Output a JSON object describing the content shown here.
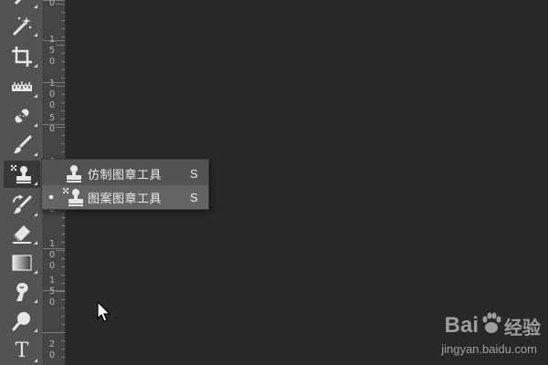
{
  "toolbar": {
    "tools": [
      {
        "name": "quick-selection-tool",
        "icon": "quick-selection-icon",
        "active": false
      },
      {
        "name": "magic-wand-tool",
        "icon": "magic-wand-icon",
        "active": false
      },
      {
        "name": "crop-tool",
        "icon": "crop-icon",
        "active": false
      },
      {
        "name": "ruler-tool",
        "icon": "ruler-icon",
        "active": false
      },
      {
        "name": "healing-brush-tool",
        "icon": "healing-bandage-icon",
        "active": false
      },
      {
        "name": "brush-tool",
        "icon": "brush-icon",
        "active": false
      },
      {
        "name": "pattern-stamp-tool",
        "icon": "pattern-stamp-icon",
        "active": true
      },
      {
        "name": "history-brush-tool",
        "icon": "history-brush-icon",
        "active": false
      },
      {
        "name": "eraser-tool",
        "icon": "eraser-icon",
        "active": false
      },
      {
        "name": "gradient-tool",
        "icon": "gradient-icon",
        "active": false
      },
      {
        "name": "smudge-tool",
        "icon": "smudge-finger-icon",
        "active": false
      },
      {
        "name": "dodge-tool",
        "icon": "dodge-icon",
        "active": false
      },
      {
        "name": "type-tool",
        "icon": "type-icon",
        "active": false
      }
    ],
    "type_tool_glyph": "T"
  },
  "ruler": {
    "labels": [
      {
        "digits": [
          "0"
        ]
      },
      {
        "digits": [
          "1",
          "5",
          "0"
        ]
      },
      {
        "digits": [
          "1",
          "0",
          "0"
        ]
      },
      {
        "digits": [
          "5",
          "0"
        ]
      },
      {
        "digits": [
          "0"
        ]
      },
      {
        "digits": [
          "5",
          "0"
        ]
      },
      {
        "digits": [
          "1",
          "0",
          "0"
        ]
      },
      {
        "digits": [
          "1",
          "5",
          "0"
        ]
      },
      {
        "digits": [
          "2",
          "0"
        ]
      }
    ]
  },
  "flyout": {
    "items": [
      {
        "label": "仿制图章工具",
        "shortcut": "S",
        "icon": "clone-stamp-icon",
        "selected": false
      },
      {
        "label": "图案图章工具",
        "shortcut": "S",
        "icon": "pattern-stamp-icon",
        "selected": true
      }
    ]
  },
  "watermark": {
    "logo_text": "Bai",
    "logo_suffix": "经验",
    "url": "jingyan.baidu.com",
    "paw_icon": "baidu-paw-icon"
  },
  "colors": {
    "toolbar_bg": "#535353",
    "canvas_bg": "#282828",
    "ruler_bg": "#454545",
    "flyout_selected_bg": "#646464",
    "icon_color": "#e6e6e6"
  }
}
